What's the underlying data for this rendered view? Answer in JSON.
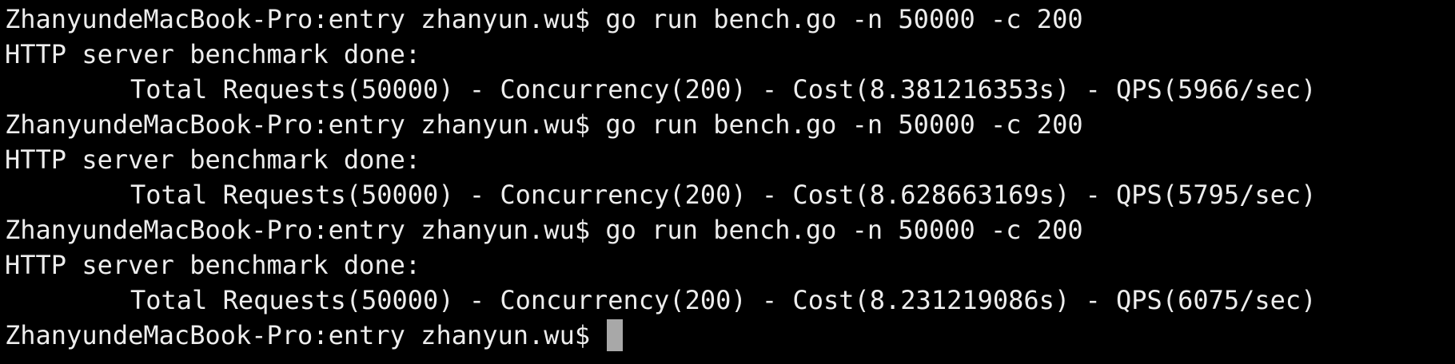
{
  "terminal": {
    "lines": [
      {
        "kind": "command",
        "text": "ZhanyundeMacBook-Pro:entry zhanyun.wu$ go run bench.go -n 50000 -c 200"
      },
      {
        "kind": "output",
        "text": "HTTP server benchmark done:"
      },
      {
        "kind": "result",
        "text": "Total Requests(50000) - Concurrency(200) - Cost(8.381216353s) - QPS(5966/sec)"
      },
      {
        "kind": "command",
        "text": "ZhanyundeMacBook-Pro:entry zhanyun.wu$ go run bench.go -n 50000 -c 200"
      },
      {
        "kind": "output",
        "text": "HTTP server benchmark done:"
      },
      {
        "kind": "result",
        "text": "Total Requests(50000) - Concurrency(200) - Cost(8.628663169s) - QPS(5795/sec)"
      },
      {
        "kind": "command",
        "text": "ZhanyundeMacBook-Pro:entry zhanyun.wu$ go run bench.go -n 50000 -c 200"
      },
      {
        "kind": "output",
        "text": "HTTP server benchmark done:"
      },
      {
        "kind": "result",
        "text": "Total Requests(50000) - Concurrency(200) - Cost(8.231219086s) - QPS(6075/sec)"
      }
    ],
    "prompt": "ZhanyundeMacBook-Pro:entry zhanyun.wu$ ",
    "colors": {
      "background": "#000000",
      "text": "#ededed",
      "cursor": "#a8a8a8"
    }
  }
}
